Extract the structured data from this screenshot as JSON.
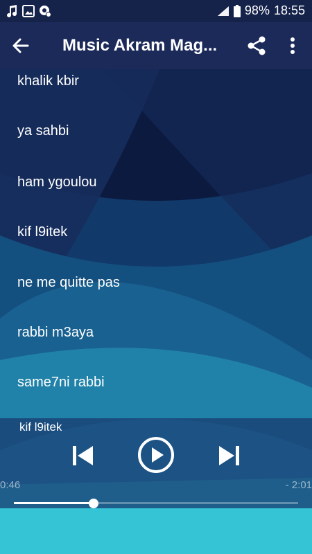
{
  "status_bar": {
    "notification_icons": [
      "music-note-icon",
      "image-icon",
      "settings-badge-icon"
    ],
    "battery": "98%",
    "time": "18:55"
  },
  "app_bar": {
    "title": "Music Akram Mag...",
    "back_icon": "arrow-back-icon",
    "share_icon": "share-icon",
    "more_icon": "more-vert-icon"
  },
  "songs": [
    "khalik kbir",
    "ya sahbi",
    "ham ygoulou",
    "kif l9itek",
    "ne me quitte pas",
    "rabbi m3aya",
    "same7ni rabbi"
  ],
  "player": {
    "current_track": "kif l9itek",
    "elapsed": "0:46",
    "remaining": "- 2:01",
    "progress": 0.28
  },
  "colors": {
    "status_bar": "#15224a",
    "app_bar": "#1c2a5a",
    "player_panel": "#18386e",
    "accent_light": "#35c3d6"
  }
}
